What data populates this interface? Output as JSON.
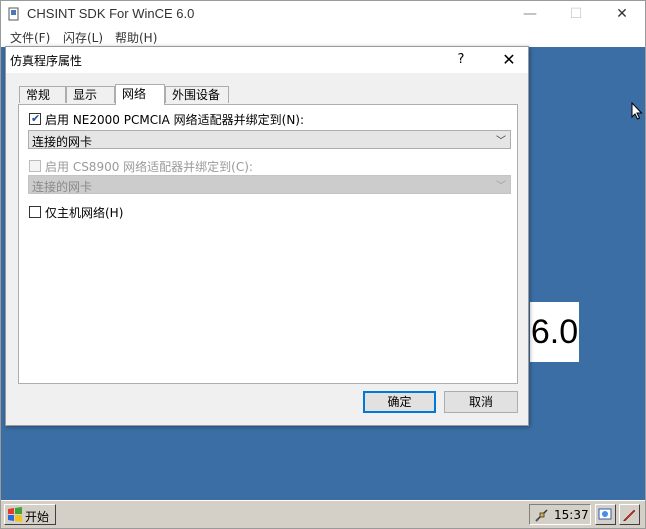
{
  "outer": {
    "title": "CHSINT SDK For WinCE 6.0",
    "menu": [
      "文件(F)",
      "闪存(L)",
      "帮助(H)"
    ],
    "controls": {
      "minimize": "—",
      "maximize": "☐",
      "close": "✕"
    }
  },
  "screen": {
    "tile_text": "6.0"
  },
  "taskbar": {
    "start_label": "开始",
    "clock": "15:37"
  },
  "dialog": {
    "title": "仿真程序属性",
    "help": "?",
    "close": "✕",
    "tabs": [
      "常规",
      "显示",
      "网络",
      "外围设备"
    ],
    "active_tab": "网络",
    "ne2000": {
      "label": "启用 NE2000 PCMCIA 网络适配器并绑定到(N):",
      "checked": true,
      "value": "连接的网卡"
    },
    "cs8900": {
      "label": "启用 CS8900 网络适配器并绑定到(C):",
      "checked": false,
      "disabled": true,
      "value": "连接的网卡"
    },
    "hostonly": {
      "label": "仅主机网络(H)",
      "checked": false
    },
    "ok_label": "确定",
    "cancel_label": "取消"
  },
  "colors": {
    "desktop": "#3a6ea5",
    "accent": "#0078d7"
  }
}
